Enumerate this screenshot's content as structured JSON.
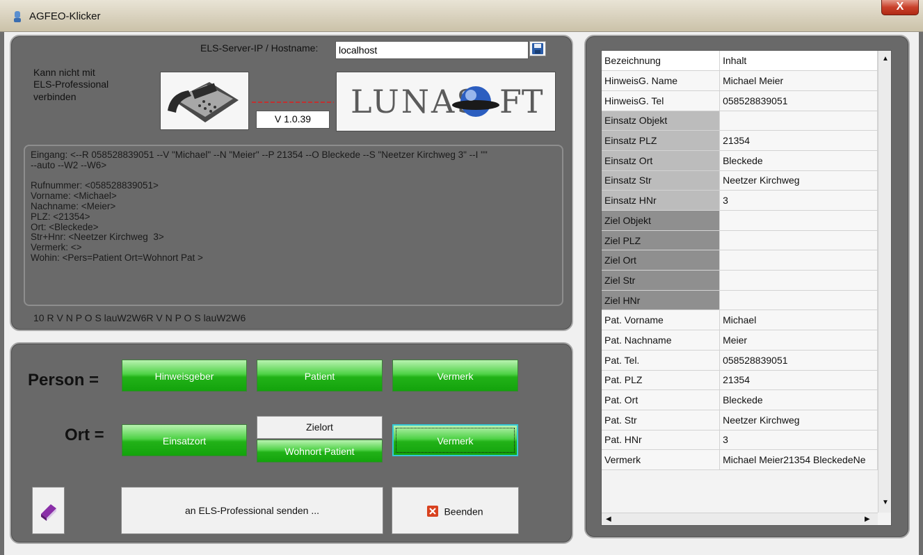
{
  "window": {
    "title": "AGFEO-Klicker",
    "close_label": "X"
  },
  "server": {
    "label": "ELS-Server-IP / Hostname:",
    "value": "localhost"
  },
  "status_text": [
    "Kann nicht mit",
    "ELS-Professional",
    "verbinden"
  ],
  "version": "V 1.0.39",
  "logo_text": "LUNASOFT",
  "log_lines": [
    "Eingang: <--R 058528839051 --V \"Michael\" --N \"Meier\" --P 21354 --O Bleckede --S \"Neetzer Kirchweg 3\" --I \"\"",
    "--auto --W2 --W6>",
    "",
    "Rufnummer: <058528839051>",
    "Vorname: <Michael>",
    "Nachname: <Meier>",
    "PLZ: <21354>",
    "Ort: <Bleckede>",
    "Str+Hnr: <Neetzer Kirchweg  3>",
    "Vermerk: <>",
    "Wohin: <Pers=Patient Ort=Wohnort Pat >"
  ],
  "status_line": "10 R V N P O S lauW2W6R V N P O S lauW2W6",
  "person": {
    "label": "Person =",
    "buttons": [
      "Hinweisgeber",
      "Patient",
      "Vermerk"
    ]
  },
  "ort": {
    "label": "Ort =",
    "einsatzort": "Einsatzort",
    "zielort": "Zielort",
    "wohnort": "Wohnort Patient",
    "vermerk": "Vermerk"
  },
  "actions": {
    "send": "an ELS-Professional senden ...",
    "quit": "Beenden"
  },
  "table": {
    "headers": [
      "Bezeichnung",
      "Inhalt"
    ],
    "rows": [
      {
        "key": "HinweisG. Name",
        "value": "Michael Meier",
        "shade": "white"
      },
      {
        "key": "HinweisG. Tel",
        "value": "058528839051",
        "shade": "white"
      },
      {
        "key": "Einsatz Objekt",
        "value": "",
        "shade": "light"
      },
      {
        "key": "Einsatz PLZ",
        "value": "21354",
        "shade": "light"
      },
      {
        "key": "Einsatz Ort",
        "value": "Bleckede",
        "shade": "light"
      },
      {
        "key": "Einsatz Str",
        "value": "Neetzer Kirchweg",
        "shade": "light"
      },
      {
        "key": "Einsatz HNr",
        "value": "3",
        "shade": "light"
      },
      {
        "key": "Ziel Objekt",
        "value": "",
        "shade": "dark"
      },
      {
        "key": "Ziel PLZ",
        "value": "",
        "shade": "dark"
      },
      {
        "key": "Ziel Ort",
        "value": "",
        "shade": "dark"
      },
      {
        "key": "Ziel Str",
        "value": "",
        "shade": "dark"
      },
      {
        "key": "Ziel HNr",
        "value": "",
        "shade": "dark"
      },
      {
        "key": "Pat. Vorname",
        "value": "Michael",
        "shade": "white"
      },
      {
        "key": "Pat. Nachname",
        "value": "Meier",
        "shade": "white"
      },
      {
        "key": "Pat. Tel.",
        "value": "058528839051",
        "shade": "white"
      },
      {
        "key": "Pat. PLZ",
        "value": "21354",
        "shade": "white"
      },
      {
        "key": "Pat. Ort",
        "value": "Bleckede",
        "shade": "white"
      },
      {
        "key": "Pat. Str",
        "value": "Neetzer Kirchweg",
        "shade": "white"
      },
      {
        "key": "Pat. HNr",
        "value": "3",
        "shade": "white"
      },
      {
        "key": "Vermerk",
        "value": "Michael Meier21354 BleckedeNe",
        "shade": "white"
      }
    ]
  }
}
